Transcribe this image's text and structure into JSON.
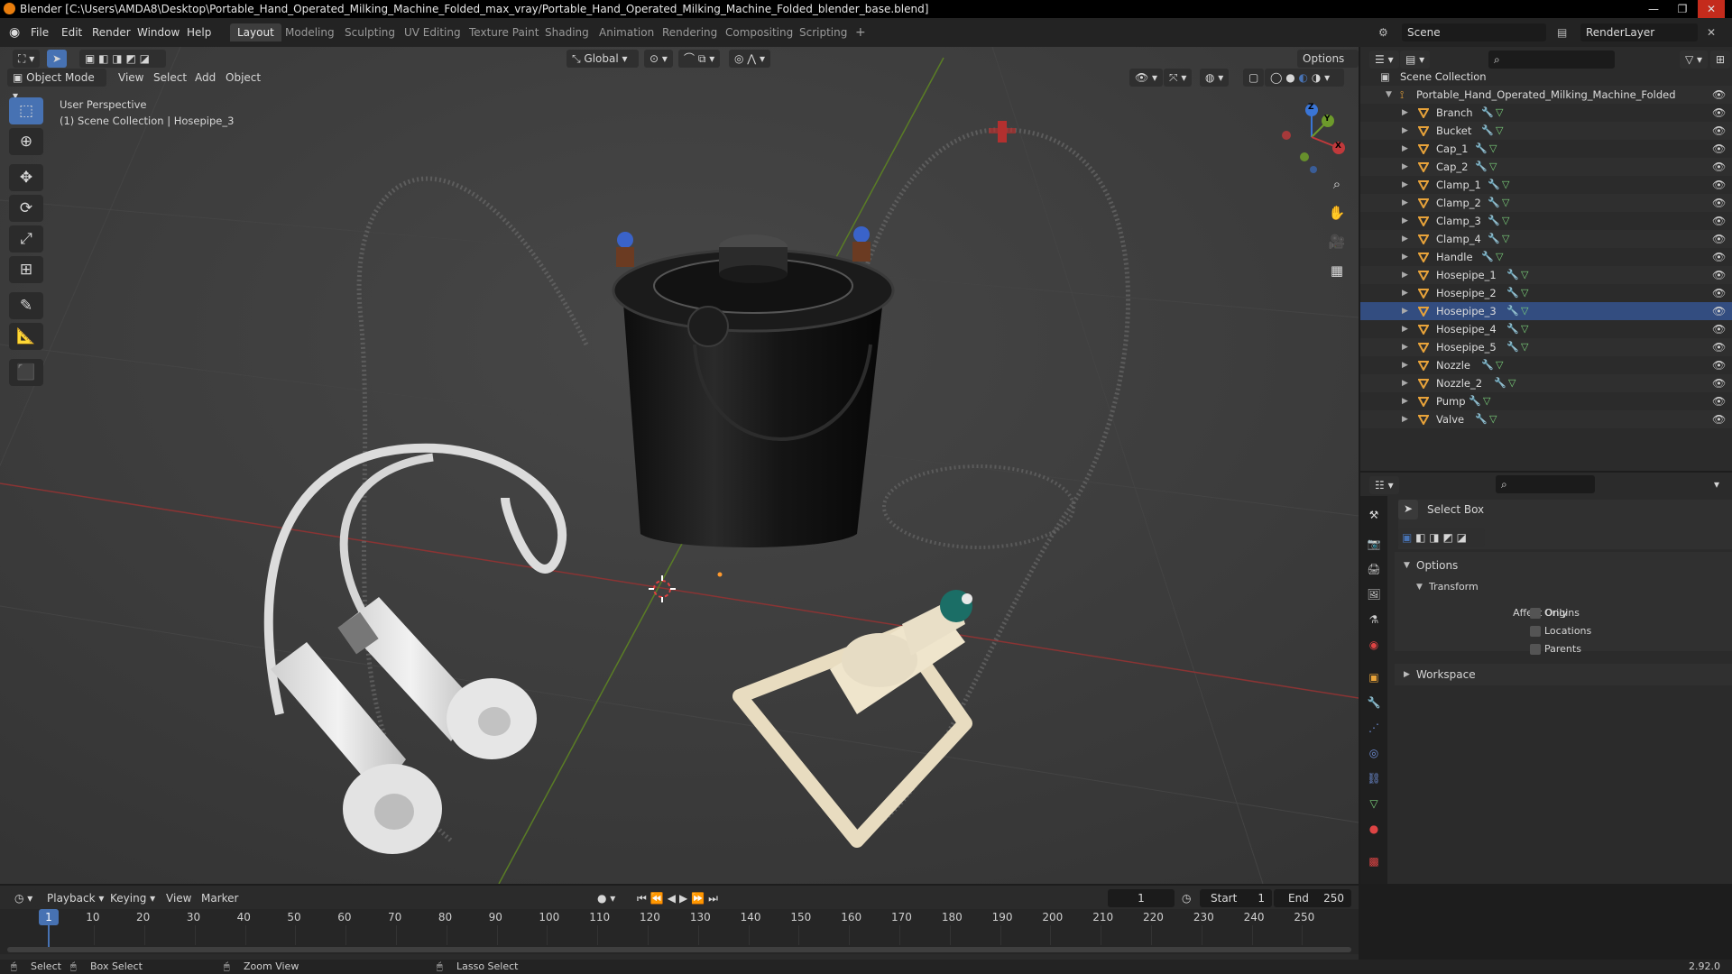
{
  "window": {
    "title": "Blender [C:\\Users\\AMDA8\\Desktop\\Portable_Hand_Operated_Milking_Machine_Folded_max_vray/Portable_Hand_Operated_Milking_Machine_Folded_blender_base.blend]",
    "controls": [
      "—",
      "❐",
      "✕"
    ]
  },
  "menu": [
    "File",
    "Edit",
    "Render",
    "Window",
    "Help"
  ],
  "workspaces": [
    "Layout",
    "Modeling",
    "Sculpting",
    "UV Editing",
    "Texture Paint",
    "Shading",
    "Animation",
    "Rendering",
    "Compositing",
    "Scripting",
    "+"
  ],
  "active_workspace": "Layout",
  "scene": {
    "label": "Scene",
    "render_layer": "RenderLayer"
  },
  "viewport_header": {
    "mode": "Object Mode",
    "menus": [
      "View",
      "Select",
      "Add",
      "Object"
    ],
    "transform_orientation": "Global",
    "options": "Options"
  },
  "viewport_info": {
    "perspective": "User Perspective",
    "collection": "(1) Scene Collection | Hosepipe_3"
  },
  "gizmo": {
    "x": "X",
    "y": "Y",
    "z": "Z"
  },
  "outliner": {
    "root": "Scene Collection",
    "collection": "Portable_Hand_Operated_Milking_Machine_Folded",
    "objects": [
      "Branch",
      "Bucket",
      "Cap_1",
      "Cap_2",
      "Clamp_1",
      "Clamp_2",
      "Clamp_3",
      "Clamp_4",
      "Handle",
      "Hosepipe_1",
      "Hosepipe_2",
      "Hosepipe_3",
      "Hosepipe_4",
      "Hosepipe_5",
      "Nozzle",
      "Nozzle_2",
      "Pump",
      "Valve"
    ],
    "selected": "Hosepipe_3"
  },
  "properties": {
    "tool": "Select Box",
    "options_label": "Options",
    "transform_label": "Transform",
    "affect_only": "Affect Only",
    "checks": [
      "Origins",
      "Locations",
      "Parents"
    ],
    "workspace_label": "Workspace"
  },
  "timeline": {
    "menus": [
      "Playback",
      "Keying",
      "View",
      "Marker"
    ],
    "current_frame": "1",
    "start_label": "Start",
    "start": "1",
    "end_label": "End",
    "end": "250",
    "ticks": [
      "1",
      "10",
      "20",
      "30",
      "40",
      "50",
      "60",
      "70",
      "80",
      "90",
      "100",
      "110",
      "120",
      "130",
      "140",
      "150",
      "160",
      "170",
      "180",
      "190",
      "200",
      "210",
      "220",
      "230",
      "240",
      "250"
    ]
  },
  "statusbar": {
    "select": "Select",
    "box_select": "Box Select",
    "zoom_view": "Zoom View",
    "lasso_select": "Lasso Select",
    "version": "2.92.0"
  },
  "colors": {
    "accent": "#4772b3",
    "selection_row": "#334d80",
    "x_axis": "#c0393b",
    "y_axis": "#6d9a2b",
    "object_orange": "#e8a33a"
  }
}
